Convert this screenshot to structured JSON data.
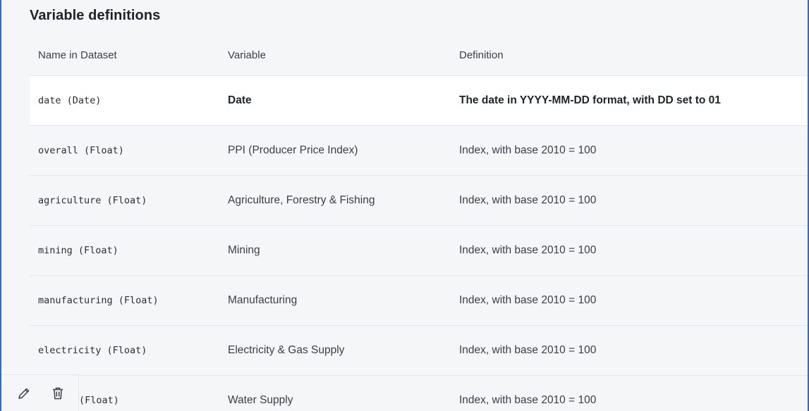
{
  "section": {
    "title": "Variable definitions"
  },
  "table": {
    "headers": [
      "Name in Dataset",
      "Variable",
      "Definition"
    ],
    "rows": [
      {
        "name": "date (Date)",
        "variable": "Date",
        "definition": "The date in YYYY-MM-DD format, with DD set to 01"
      },
      {
        "name": "overall (Float)",
        "variable": "PPI (Producer Price Index)",
        "definition": "Index, with base 2010 = 100"
      },
      {
        "name": "agriculture (Float)",
        "variable": "Agriculture, Forestry & Fishing",
        "definition": "Index, with base 2010 = 100"
      },
      {
        "name": "mining (Float)",
        "variable": "Mining",
        "definition": "Index, with base 2010 = 100"
      },
      {
        "name": "manufacturing (Float)",
        "variable": "Manufacturing",
        "definition": "Index, with base 2010 = 100"
      },
      {
        "name": "electricity (Float)",
        "variable": "Electricity & Gas Supply",
        "definition": "Index, with base 2010 = 100"
      },
      {
        "name": "(Float)",
        "variable": "Water Supply",
        "definition": "Index, with base 2010 = 100"
      }
    ]
  },
  "toolbar": {
    "edit_icon": "pencil-icon",
    "delete_icon": "trash-icon"
  },
  "colors": {
    "selection_border": "#1f6fd6",
    "panel_background": "#f5f6f8",
    "highlight_row": "#ffffff"
  }
}
